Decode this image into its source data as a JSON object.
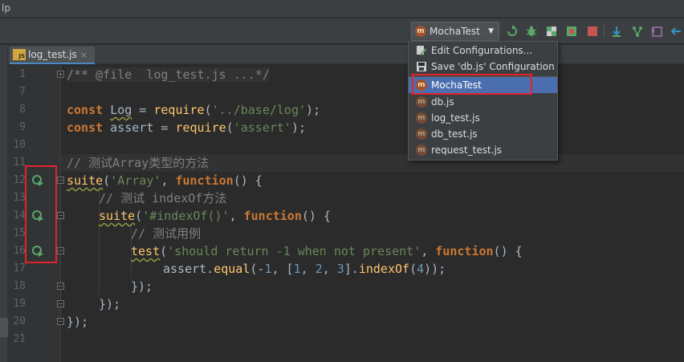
{
  "window": {
    "title_fragment": "lp"
  },
  "toolbar": {
    "run_config_label": "MochaTest",
    "icons": [
      "rerun-icon",
      "debug-icon",
      "coverage-icon",
      "profile-icon",
      "stop-icon",
      "pull-icon",
      "vcs-branch-icon",
      "undo-icon",
      "back-arrow-icon"
    ]
  },
  "tab": {
    "filename": "log_test.js",
    "file_type_badge": "JS",
    "close_glyph": "×"
  },
  "dropdown": {
    "items": [
      {
        "label": "Edit Configurations...",
        "icon": "edit-config-icon"
      },
      {
        "label": "Save 'db.js' Configuration",
        "icon": "save-icon"
      },
      {
        "label": "MochaTest",
        "icon": "mocha-icon",
        "selected": true
      },
      {
        "label": "db.js",
        "icon": "mocha-icon"
      },
      {
        "label": "log_test.js",
        "icon": "mocha-icon"
      },
      {
        "label": "db_test.js",
        "icon": "mocha-icon"
      },
      {
        "label": "request_test.js",
        "icon": "mocha-icon"
      }
    ]
  },
  "editor": {
    "line_numbers": [
      "1",
      "7",
      "8",
      "9",
      "10",
      "11",
      "12",
      "13",
      "14",
      "15",
      "16",
      "17",
      "18",
      "19",
      "20",
      "21"
    ],
    "lines": {
      "l1": "/** @file  log_test.js ...*/",
      "l8_kw": "const",
      "l8_var": "Log",
      "l8_eq": " = ",
      "l8_fn": "require",
      "l8_open": "(",
      "l8_str": "'../base/log'",
      "l8_close": ");",
      "l9_kw": "const",
      "l9_rest": " assert = ",
      "l9_fn": "require",
      "l9_open": "(",
      "l9_str": "'assert'",
      "l9_close": ");",
      "l11": "// 测试Array类型的方法",
      "l12_fn": "suite",
      "l12_open": "(",
      "l12_str": "'Array'",
      "l12_comma": ", ",
      "l12_kw": "function",
      "l12_rest": "() {",
      "l13": "// 测试 indexOf方法",
      "l14_fn": "suite",
      "l14_open": "(",
      "l14_str": "'#indexOf()'",
      "l14_comma": ", ",
      "l14_kw": "function",
      "l14_rest": "() {",
      "l15": "// 测试用例",
      "l16_fn": "test",
      "l16_open": "(",
      "l16_str": "'should return -1 when not present'",
      "l16_comma": ", ",
      "l16_kw": "function",
      "l16_rest": "() {",
      "l17_a": "assert.",
      "l17_fn": "equal",
      "l17_b": "(-",
      "l17_n1": "1",
      "l17_c": ", [",
      "l17_n2": "1",
      "l17_d": ", ",
      "l17_n3": "2",
      "l17_e": ", ",
      "l17_n4": "3",
      "l17_f": "].",
      "l17_fn2": "indexOf",
      "l17_g": "(",
      "l17_n5": "4",
      "l17_h": "));",
      "l18": "});",
      "l19": "});",
      "l20": "});"
    }
  },
  "colors": {
    "keyword": "#cc7832",
    "string": "#6a8759",
    "number": "#6897bb",
    "comment": "#808080",
    "function": "#ffc66d",
    "highlight_box": "#e3232c",
    "selection": "#4b6eaf"
  }
}
